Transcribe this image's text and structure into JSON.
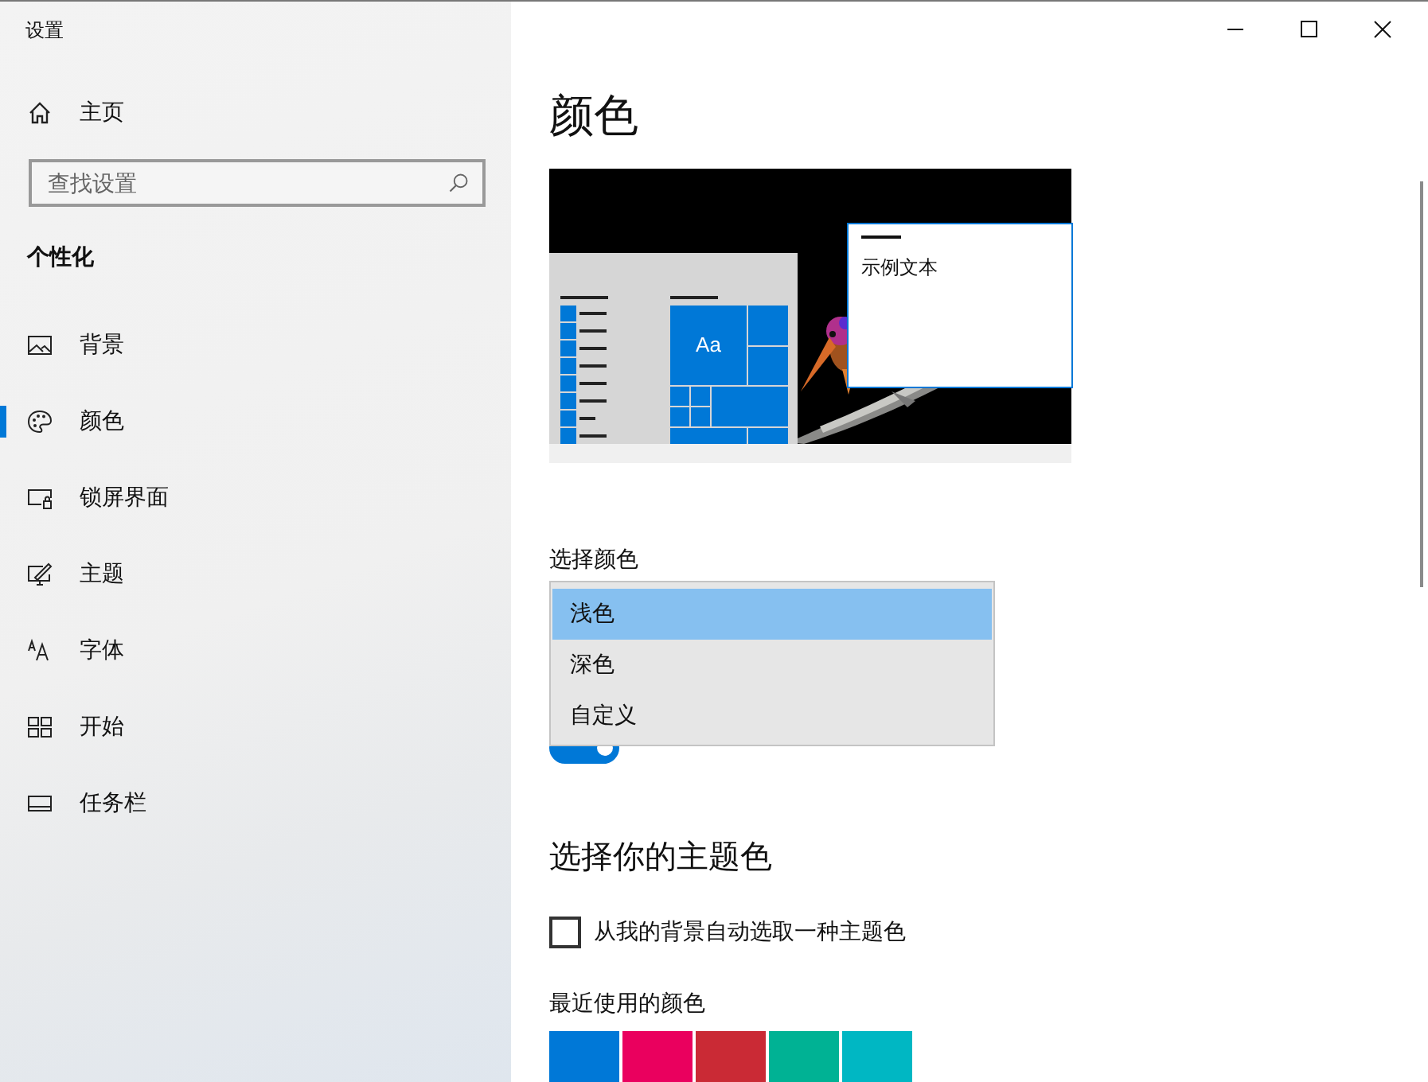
{
  "window": {
    "title": "设置"
  },
  "sidebar": {
    "home": {
      "label": "主页"
    },
    "search": {
      "placeholder": "查找设置"
    },
    "section": "个性化",
    "items": [
      {
        "label": "背景",
        "selected": false
      },
      {
        "label": "颜色",
        "selected": true
      },
      {
        "label": "锁屏界面",
        "selected": false
      },
      {
        "label": "主题",
        "selected": false
      },
      {
        "label": "字体",
        "selected": false
      },
      {
        "label": "开始",
        "selected": false
      },
      {
        "label": "任务栏",
        "selected": false
      }
    ]
  },
  "main": {
    "title": "颜色",
    "preview": {
      "tile_text": "Aa",
      "sample_text": "示例文本"
    },
    "choose_color": {
      "label": "选择颜色",
      "options": [
        {
          "label": "浅色",
          "selected": true
        },
        {
          "label": "深色",
          "selected": false
        },
        {
          "label": "自定义",
          "selected": false
        }
      ]
    },
    "toggle": {
      "on": true
    },
    "accent": {
      "heading": "选择你的主题色",
      "auto_checkbox": {
        "label": "从我的背景自动选取一种主题色",
        "checked": false
      },
      "recent_label": "最近使用的颜色",
      "recent_colors": [
        {
          "color": "#0078d7"
        },
        {
          "color": "#ea005e"
        },
        {
          "color": "#ca2a35"
        },
        {
          "color": "#00b294"
        },
        {
          "color": "#00b7c3"
        }
      ]
    }
  }
}
